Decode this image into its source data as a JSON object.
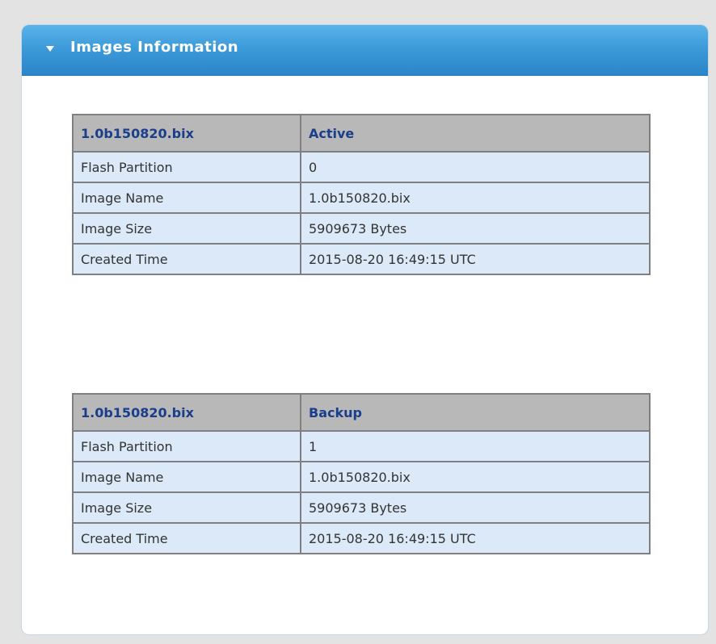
{
  "panel": {
    "title": "Images Information",
    "accent_color": "#3d9bd9"
  },
  "images": [
    {
      "header": {
        "file": "1.0b150820.bix",
        "status": "Active"
      },
      "rows": [
        {
          "label": "Flash Partition",
          "value": "0"
        },
        {
          "label": "Image Name",
          "value": "1.0b150820.bix"
        },
        {
          "label": "Image Size",
          "value": "5909673 Bytes"
        },
        {
          "label": "Created Time",
          "value": "2015-08-20 16:49:15 UTC"
        }
      ]
    },
    {
      "header": {
        "file": "1.0b150820.bix",
        "status": "Backup"
      },
      "rows": [
        {
          "label": "Flash Partition",
          "value": "1"
        },
        {
          "label": "Image Name",
          "value": "1.0b150820.bix"
        },
        {
          "label": "Image Size",
          "value": "5909673 Bytes"
        },
        {
          "label": "Created Time",
          "value": "2015-08-20 16:49:15 UTC"
        }
      ]
    }
  ]
}
